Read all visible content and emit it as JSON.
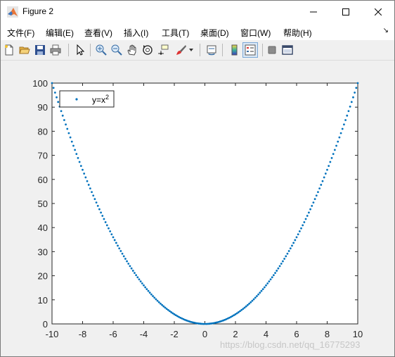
{
  "window": {
    "title": "Figure 2"
  },
  "menu": [
    "文件(F)",
    "编辑(E)",
    "查看(V)",
    "插入(I)",
    "工具(T)",
    "桌面(D)",
    "窗口(W)",
    "帮助(H)"
  ],
  "menu_overflow": "↘",
  "toolbar": [
    "new-figure-icon",
    "open-file-icon",
    "save-icon",
    "print-icon",
    "pointer-icon",
    "zoom-in-icon",
    "zoom-out-icon",
    "pan-hand-icon",
    "rotate-3d-icon",
    "data-cursor-icon",
    "brush-icon",
    "link-plot-icon",
    "colorbar-icon",
    "legend-icon",
    "hide-plot-tools-icon",
    "show-plot-tools-icon"
  ],
  "watermark": "https://blog.csdn.net/qq_16775293",
  "colors": {
    "series": "#0072BD",
    "axes_bg": "#ffffff",
    "figure_bg": "#f0f0f0"
  },
  "chart_data": {
    "type": "scatter",
    "title": "",
    "xlabel": "",
    "ylabel": "",
    "xlim": [
      -10,
      10
    ],
    "ylim": [
      0,
      100
    ],
    "xticks": [
      "-10",
      "-8",
      "-6",
      "-4",
      "-2",
      "0",
      "2",
      "4",
      "6",
      "8",
      "10"
    ],
    "yticks": [
      "0",
      "10",
      "20",
      "30",
      "40",
      "50",
      "60",
      "70",
      "80",
      "90",
      "100"
    ],
    "grid": false,
    "legend_position": "top-left",
    "series": [
      {
        "name": "y=x",
        "name_superscript": "2",
        "marker": "point",
        "color": "#0072BD",
        "function": "x^2",
        "x_range": [
          -10,
          10
        ],
        "x_step": 0.1
      }
    ]
  }
}
